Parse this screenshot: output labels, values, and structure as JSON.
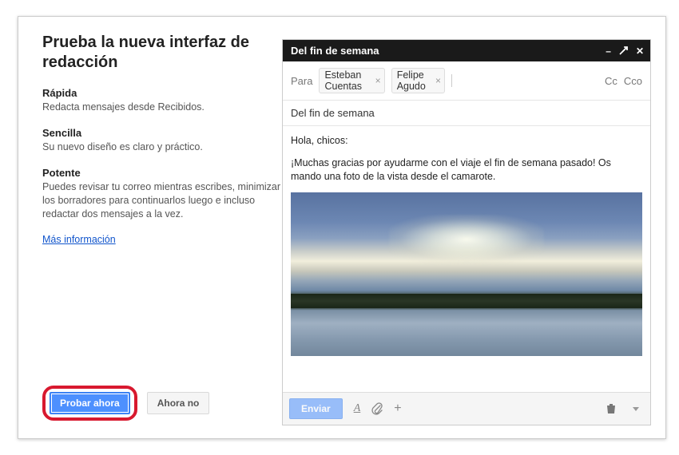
{
  "modal": {
    "title": "Prueba la nueva interfaz de redacción",
    "features": [
      {
        "title": "Rápida",
        "desc": "Redacta mensajes desde Recibidos."
      },
      {
        "title": "Sencilla",
        "desc": "Su nuevo diseño es claro y práctico."
      },
      {
        "title": "Potente",
        "desc": "Puedes revisar tu correo mientras escribes, minimizar los borradores para continuarlos luego e incluso redactar dos mensajes a la vez."
      }
    ],
    "more_info": "Más información",
    "try_now": "Probar ahora",
    "not_now": "Ahora no"
  },
  "compose": {
    "title": "Del fin de semana",
    "to_label": "Para",
    "recipients": [
      "Esteban Cuentas",
      "Felipe Agudo"
    ],
    "cc": "Cc",
    "bcc": "Cco",
    "subject": "Del fin de semana",
    "body_greeting": "Hola, chicos:",
    "body_text": "¡Muchas gracias por ayudarme con el viaje el fin de semana pasado! Os mando una foto de la vista desde el camarote.",
    "send": "Enviar",
    "format_label": "A",
    "attach_glyph": "📎",
    "insert_glyph": "+"
  }
}
